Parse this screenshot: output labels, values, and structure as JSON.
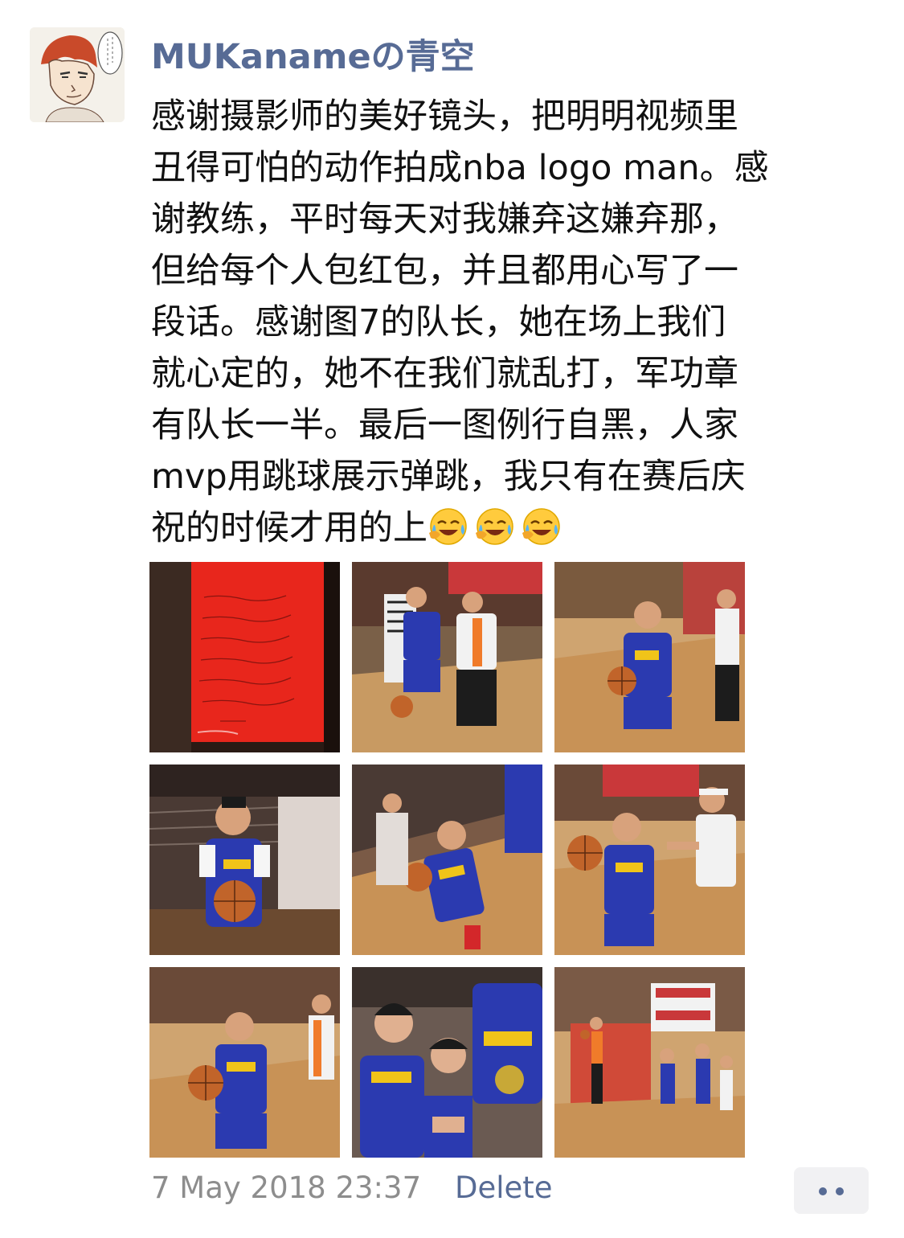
{
  "post": {
    "username": "MUKanameの青空",
    "text_lines": [
      "感谢摄影师的美好镜头，把明明视频里",
      "丑得可怕的动作拍成nba logo man。感",
      "谢教练，平时每天对我嫌弃这嫌弃那，",
      "但给每个人包红包，并且都用心写了一",
      "段话。感谢图7的队长，她在场上我们",
      "就心定的，她不在我们就乱打，军功章",
      "有队长一半。最后一图例行自黑，人家",
      "mvp用跳球展示弹跳，我只有在赛后庆",
      "祝的时候才用的上"
    ],
    "emoji_name": "laughing-crying-emoji",
    "timestamp": "7 May 2018 23:37",
    "delete_label": "Delete",
    "photos": [
      "red-envelope-handwritten-note",
      "player-dribbling-vs-defender",
      "player-dribbling-court",
      "player-holding-ball-close",
      "player-dribbling-tilted",
      "player-ball-defender-reaching",
      "player-dribbling-layup",
      "team-celebration",
      "jump-ball-wide-shot"
    ]
  },
  "colors": {
    "name_link": "#576b95",
    "timestamp": "#8d8d8d",
    "jersey": "#2b3ab0",
    "jersey_trim": "#f0c419",
    "court": "#b98a55",
    "envelope": "#e8261c"
  }
}
